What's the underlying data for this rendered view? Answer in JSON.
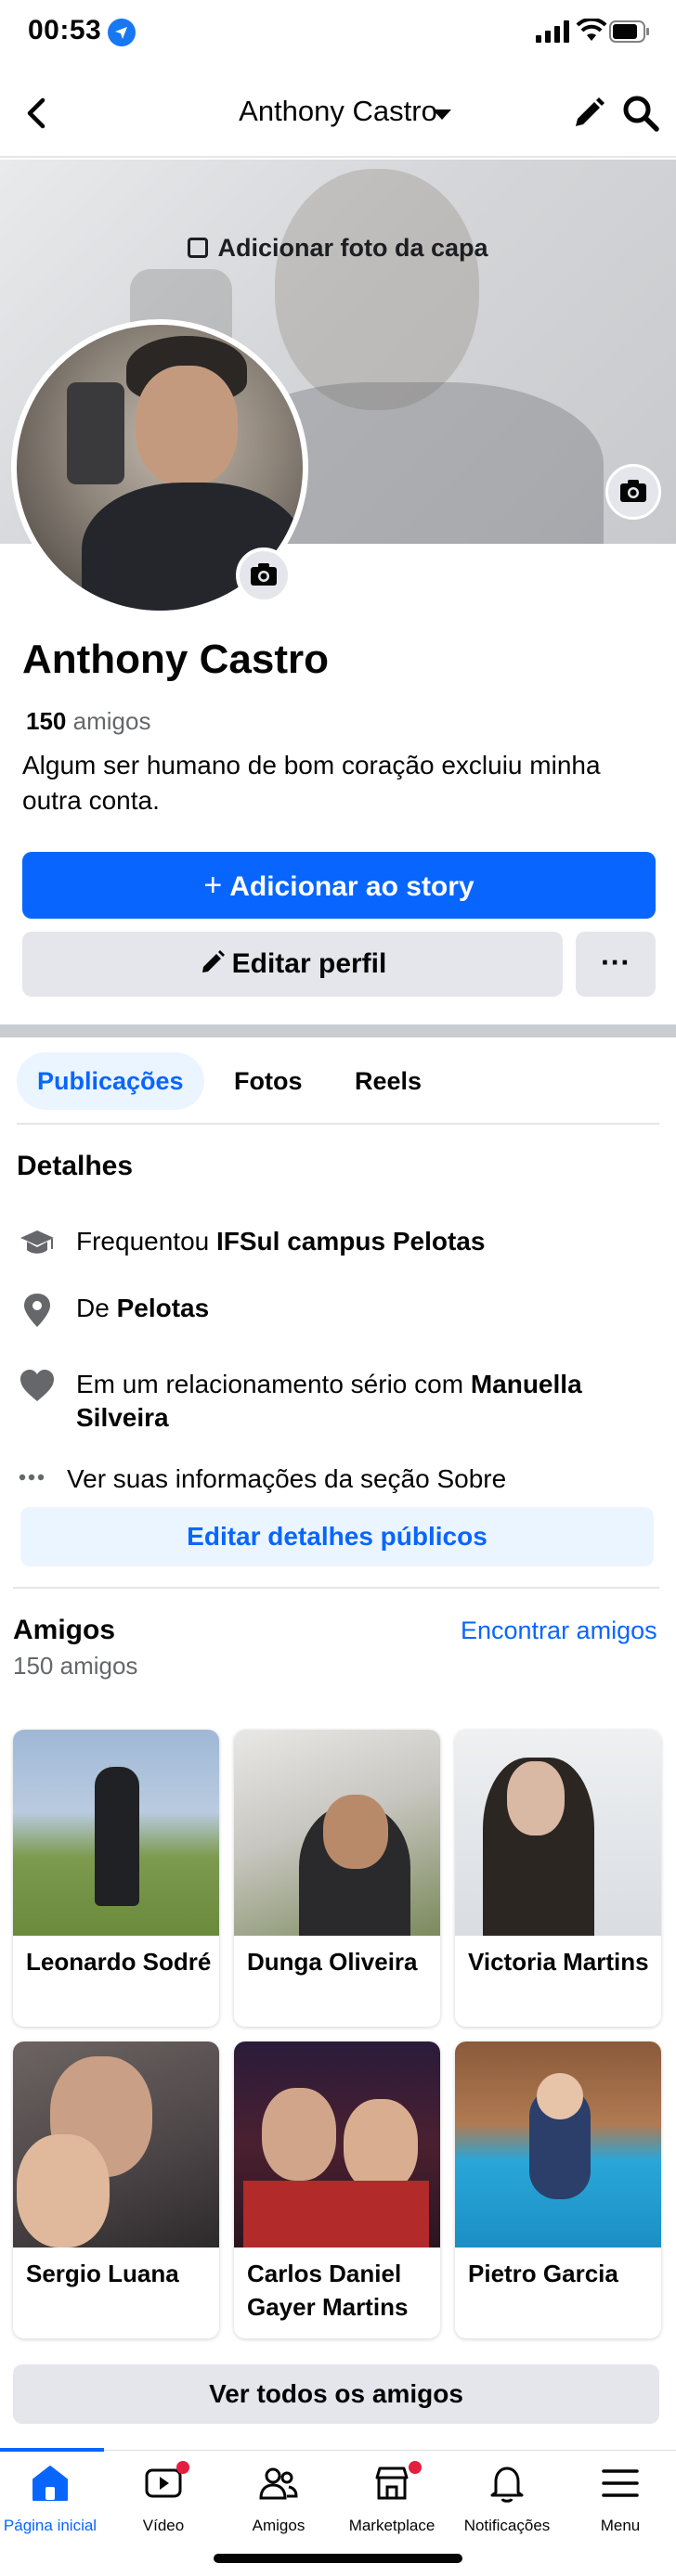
{
  "status_bar": {
    "time": "00:53"
  },
  "header": {
    "title": "Anthony Castro"
  },
  "cover": {
    "add_cover_label": "Adicionar foto da capa"
  },
  "profile": {
    "name": "Anthony Castro",
    "friends_count": "150",
    "friends_word": "amigos",
    "bio": "Algum ser humano de bom coração excluiu minha outra conta."
  },
  "actions": {
    "add_story_label": "Adicionar ao story",
    "edit_profile_label": "Editar perfil",
    "more_label": "···"
  },
  "tabs": [
    {
      "label": "Publicações",
      "active": true
    },
    {
      "label": "Fotos",
      "active": false
    },
    {
      "label": "Reels",
      "active": false
    }
  ],
  "details": {
    "heading": "Detalhes",
    "education_prefix": "Frequentou ",
    "education_place": "IFSul campus Pelotas",
    "hometown_prefix": "De ",
    "hometown_place": "Pelotas",
    "relationship_prefix": "Em um relacionamento sério com ",
    "relationship_partner": "Manuella Silveira",
    "about_link": "Ver suas informações da seção Sobre",
    "edit_button": "Editar detalhes públicos"
  },
  "friends": {
    "heading": "Amigos",
    "count_label": "150 amigos",
    "find_link": "Encontrar amigos",
    "list": [
      {
        "name": "Leonardo Sodré"
      },
      {
        "name": "Dunga Oliveira"
      },
      {
        "name": "Victoria Martins"
      },
      {
        "name": "Sergio Luana"
      },
      {
        "name": "Carlos Daniel Gayer Martins"
      },
      {
        "name": "Pietro Garcia"
      }
    ],
    "see_all_button": "Ver todos os amigos"
  },
  "bottom_nav": [
    {
      "label": "Página inicial",
      "icon": "home-icon",
      "active": true
    },
    {
      "label": "Vídeo",
      "icon": "video-icon",
      "active": false,
      "badge": true
    },
    {
      "label": "Amigos",
      "icon": "friends-icon",
      "active": false
    },
    {
      "label": "Marketplace",
      "icon": "marketplace-icon",
      "active": false,
      "badge": true
    },
    {
      "label": "Notificações",
      "icon": "bell-icon",
      "active": false
    },
    {
      "label": "Menu",
      "icon": "menu-icon",
      "active": false
    }
  ],
  "colors": {
    "accent": "#0866ff",
    "button_gray": "#e4e6eb",
    "tab_active_bg": "#ebf5ff",
    "badge": "#e41e3f"
  }
}
